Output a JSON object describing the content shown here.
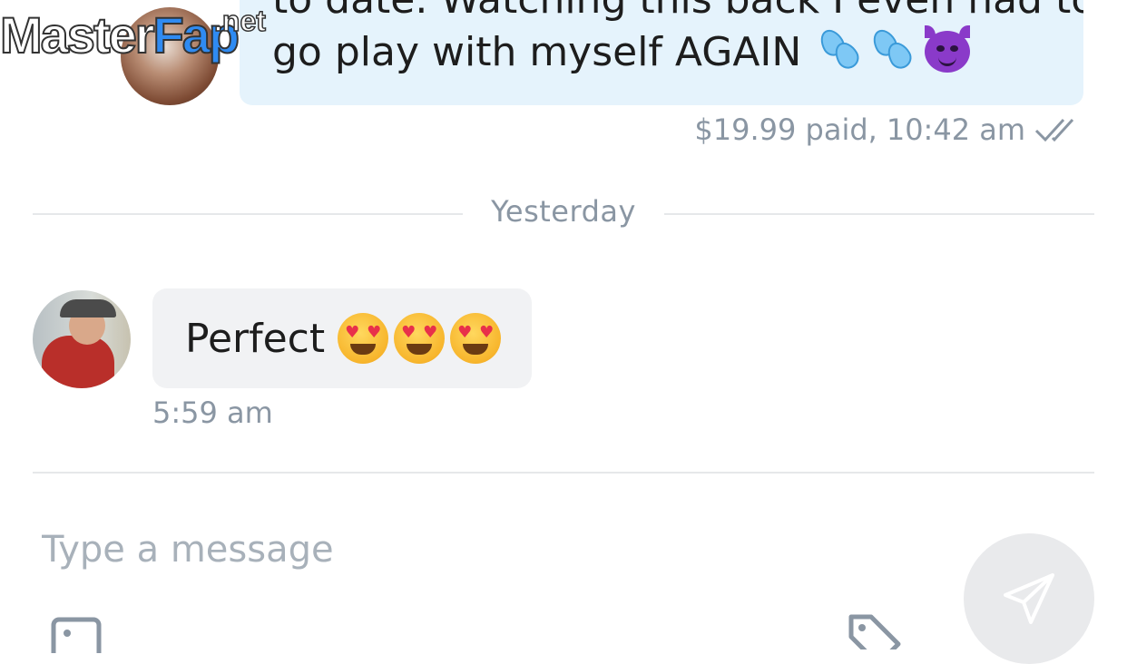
{
  "watermark": {
    "part1": "Master",
    "part2": "Fap",
    "part3": ".net"
  },
  "outgoing": {
    "line1": "to date. Watching this back I even had to",
    "line2": "go play with myself AGAIN",
    "emojis": [
      "sweat-droplets",
      "sweat-droplets",
      "smiling-devil"
    ],
    "price_status": "$19.99 paid,",
    "time": "10:42 am",
    "read_status_icon": "double-check-icon"
  },
  "divider": {
    "label": "Yesterday"
  },
  "incoming": {
    "text": "Perfect",
    "emojis": [
      "heart-eyes",
      "heart-eyes",
      "heart-eyes"
    ],
    "time": "5:59 am"
  },
  "composer": {
    "placeholder": "Type a message",
    "value": "",
    "send_icon": "paper-plane-icon",
    "media_icon": "image-icon",
    "price_icon": "price-tag-icon"
  },
  "colors": {
    "outgoing_bubble": "#e5f3fc",
    "incoming_bubble": "#f1f2f4",
    "meta_text": "#8a96a3",
    "placeholder": "#a8b1ba"
  }
}
